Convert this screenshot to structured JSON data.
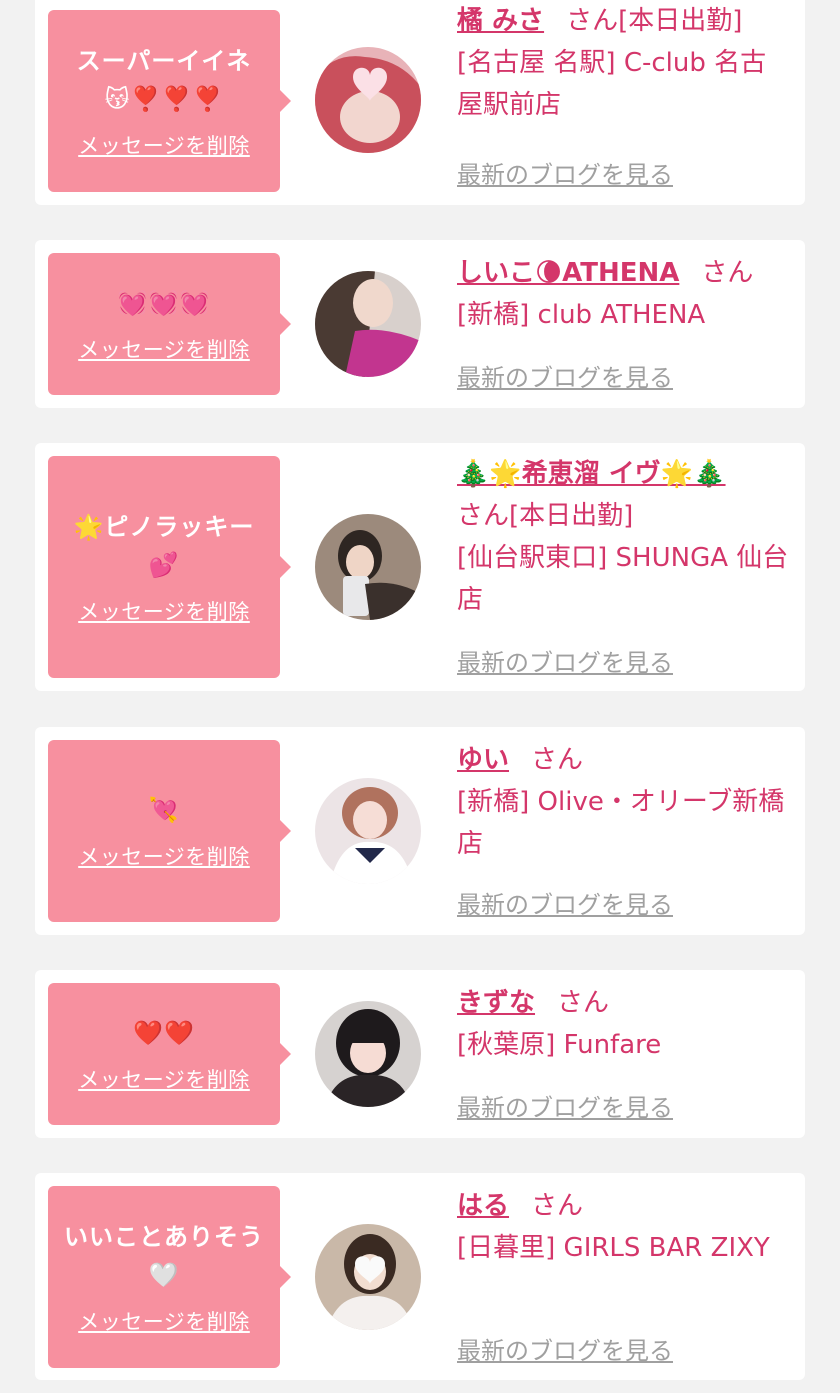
{
  "delete_label": "メッセージを削除",
  "blog_label": "最新のブログを見る",
  "colors": {
    "bubble": "#f7909f",
    "accent": "#d4366a",
    "link_gray": "#a0a0a0",
    "background": "#f2f2f2"
  },
  "cards": [
    {
      "message": "スーパーイイネ\n😽❣️❣️❣️",
      "name": "橘 みさ",
      "san": "さん[本日出勤]",
      "shop": "[名古屋 名駅] C-club 名古屋駅前店",
      "avatar_icon": "avatar-photo-icon"
    },
    {
      "message": "💓💓💓",
      "name": "しいこ🌘ATHENA",
      "san": "さん",
      "shop": "[新橋] club ATHENA",
      "avatar_icon": "avatar-photo-icon"
    },
    {
      "message": "🌟ピノラッキー\n💕",
      "name": "🎄🌟希恵溜 イヴ🌟🎄",
      "san": "さん[本日出勤]",
      "shop": "[仙台駅東口] SHUNGA 仙台店",
      "avatar_icon": "avatar-photo-icon"
    },
    {
      "message": "💘",
      "name": "ゆい",
      "san": "さん",
      "shop": "[新橋] Olive・オリーブ新橋店",
      "avatar_icon": "avatar-photo-icon"
    },
    {
      "message": "❤️❤️",
      "name": "きずな",
      "san": "さん",
      "shop": "[秋葉原] Funfare",
      "avatar_icon": "avatar-photo-icon"
    },
    {
      "message": "いいことありそう\n🤍",
      "name": "はる",
      "san": "さん",
      "shop": "[日暮里] GIRLS BAR ZIXY",
      "avatar_icon": "avatar-photo-icon"
    }
  ]
}
